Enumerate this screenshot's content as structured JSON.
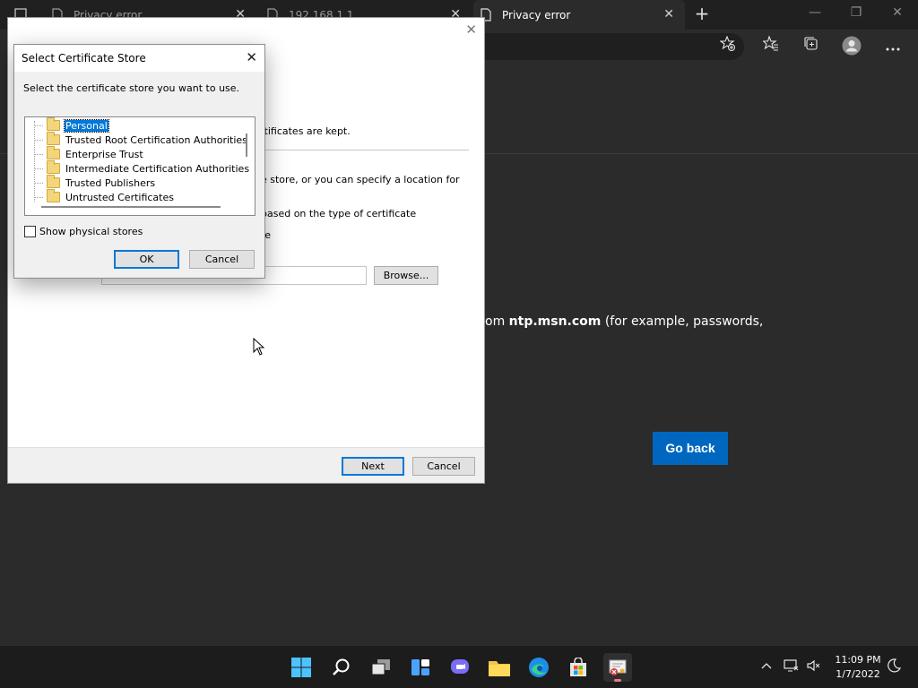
{
  "browser": {
    "tabs": [
      {
        "title": "Privacy error",
        "close": "✕"
      },
      {
        "title": "192.168.1.1",
        "close": "✕"
      },
      {
        "title": "Privacy error",
        "close": "✕"
      }
    ],
    "new_tab": "+",
    "window_controls": {
      "minimize": "—",
      "maximize": "❐",
      "close": "✕"
    }
  },
  "page": {
    "text_prefix": "om ",
    "host": "ntp.msn.com",
    "text_suffix": " (for example, passwords,",
    "go_back": "Go back"
  },
  "wizard": {
    "close": "✕",
    "line1": "rtificates are kept.",
    "line2": "e store, or you can specify a location for",
    "line3": "based on the type of certificate",
    "line4": "re",
    "browse": "Browse...",
    "next": "Next",
    "cancel": "Cancel"
  },
  "dialog": {
    "title": "Select Certificate Store",
    "close": "✕",
    "prompt": "Select the certificate store you want to use.",
    "stores": [
      "Personal",
      "Trusted Root Certification Authorities",
      "Enterprise Trust",
      "Intermediate Certification Authorities",
      "Trusted Publishers",
      "Untrusted Certificates"
    ],
    "selected_store": "Personal",
    "show_physical": "Show physical stores",
    "show_physical_checked": false,
    "ok": "OK",
    "cancel": "Cancel"
  },
  "taskbar": {
    "time": "11:09 PM",
    "date": "1/7/2022"
  },
  "colors": {
    "accent": "#0067c0",
    "selection": "#0078d7",
    "page_bg": "#2b2b2b",
    "taskbar_bg": "#1c1c1c"
  }
}
